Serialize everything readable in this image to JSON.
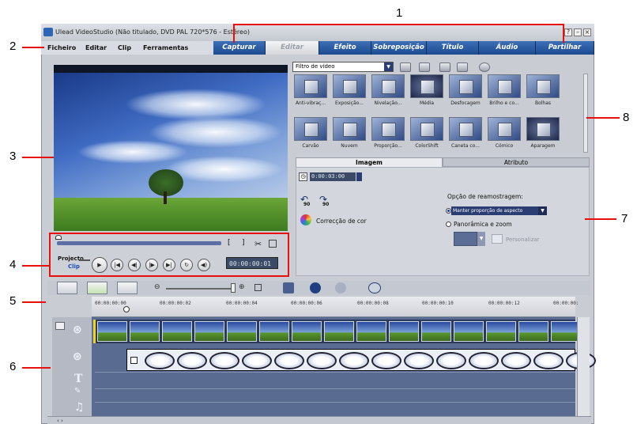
{
  "window": {
    "title": "Ulead VideoStudio (Não titulado, DVD PAL 720*576 - Estéreo)",
    "controls": [
      "?",
      "–",
      "×"
    ]
  },
  "menu": [
    "Ficheiro",
    "Editar",
    "Clip",
    "Ferramentas"
  ],
  "steps": [
    {
      "label": "Capturar",
      "active": false
    },
    {
      "label": "Editar",
      "active": true
    },
    {
      "label": "Efeito",
      "active": false
    },
    {
      "label": "Sobreposição",
      "active": false
    },
    {
      "label": "Título",
      "active": false
    },
    {
      "label": "Áudio",
      "active": false
    },
    {
      "label": "Partilhar",
      "active": false
    }
  ],
  "callouts": [
    "1",
    "2",
    "3",
    "4",
    "5",
    "6",
    "7",
    "8"
  ],
  "navigation": {
    "project_label": "Projecto",
    "clip_label": "Clip",
    "timecode": "00:00:00:01",
    "trim_marks": [
      "[",
      "]"
    ]
  },
  "library": {
    "dropdown": "Filtro de vídeo",
    "row1": [
      "Anti-vibraç...",
      "Exposição...",
      "Nivelação...",
      "Média",
      "Desfocagem",
      "Brilho e co...",
      "Bolhas"
    ],
    "row2": [
      "Carvão",
      "Nuvem",
      "Proporção...",
      "ColorShift",
      "Caneta co...",
      "Cómico",
      "Aparagem"
    ]
  },
  "options": {
    "tab_image": "Imagem",
    "tab_attribute": "Atributo",
    "duration": "0:00:03:00",
    "color_correction": "Correcção de cor",
    "rotate_left": "90",
    "rotate_right": "90",
    "resample_title": "Opção de reamostragem:",
    "resample_keep": "Manter proporção de aspecto",
    "resample_pan": "Panorâmica e zoom",
    "customize": "Personalizar"
  },
  "timeline": {
    "ticks": [
      "00:00:00:00",
      "00:00:00:02",
      "00:00:00:04",
      "00:00:00:06",
      "00:00:00:08",
      "00:00:00:10",
      "00:00:00:12",
      "00:00:00:"
    ]
  },
  "colors": {
    "tab_blue": "#1d4b8f",
    "callout_red": "#e8100c",
    "timeline_bg": "#5a6b92"
  }
}
